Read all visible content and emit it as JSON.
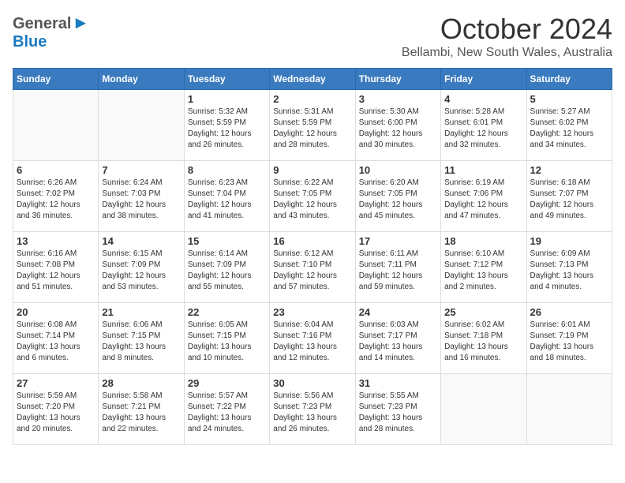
{
  "header": {
    "logo_general": "General",
    "logo_blue": "Blue",
    "month": "October 2024",
    "location": "Bellambi, New South Wales, Australia"
  },
  "weekdays": [
    "Sunday",
    "Monday",
    "Tuesday",
    "Wednesday",
    "Thursday",
    "Friday",
    "Saturday"
  ],
  "weeks": [
    [
      {
        "day": "",
        "info": ""
      },
      {
        "day": "",
        "info": ""
      },
      {
        "day": "1",
        "info": "Sunrise: 5:32 AM\nSunset: 5:59 PM\nDaylight: 12 hours and 26 minutes."
      },
      {
        "day": "2",
        "info": "Sunrise: 5:31 AM\nSunset: 5:59 PM\nDaylight: 12 hours and 28 minutes."
      },
      {
        "day": "3",
        "info": "Sunrise: 5:30 AM\nSunset: 6:00 PM\nDaylight: 12 hours and 30 minutes."
      },
      {
        "day": "4",
        "info": "Sunrise: 5:28 AM\nSunset: 6:01 PM\nDaylight: 12 hours and 32 minutes."
      },
      {
        "day": "5",
        "info": "Sunrise: 5:27 AM\nSunset: 6:02 PM\nDaylight: 12 hours and 34 minutes."
      }
    ],
    [
      {
        "day": "6",
        "info": "Sunrise: 6:26 AM\nSunset: 7:02 PM\nDaylight: 12 hours and 36 minutes."
      },
      {
        "day": "7",
        "info": "Sunrise: 6:24 AM\nSunset: 7:03 PM\nDaylight: 12 hours and 38 minutes."
      },
      {
        "day": "8",
        "info": "Sunrise: 6:23 AM\nSunset: 7:04 PM\nDaylight: 12 hours and 41 minutes."
      },
      {
        "day": "9",
        "info": "Sunrise: 6:22 AM\nSunset: 7:05 PM\nDaylight: 12 hours and 43 minutes."
      },
      {
        "day": "10",
        "info": "Sunrise: 6:20 AM\nSunset: 7:05 PM\nDaylight: 12 hours and 45 minutes."
      },
      {
        "day": "11",
        "info": "Sunrise: 6:19 AM\nSunset: 7:06 PM\nDaylight: 12 hours and 47 minutes."
      },
      {
        "day": "12",
        "info": "Sunrise: 6:18 AM\nSunset: 7:07 PM\nDaylight: 12 hours and 49 minutes."
      }
    ],
    [
      {
        "day": "13",
        "info": "Sunrise: 6:16 AM\nSunset: 7:08 PM\nDaylight: 12 hours and 51 minutes."
      },
      {
        "day": "14",
        "info": "Sunrise: 6:15 AM\nSunset: 7:09 PM\nDaylight: 12 hours and 53 minutes."
      },
      {
        "day": "15",
        "info": "Sunrise: 6:14 AM\nSunset: 7:09 PM\nDaylight: 12 hours and 55 minutes."
      },
      {
        "day": "16",
        "info": "Sunrise: 6:12 AM\nSunset: 7:10 PM\nDaylight: 12 hours and 57 minutes."
      },
      {
        "day": "17",
        "info": "Sunrise: 6:11 AM\nSunset: 7:11 PM\nDaylight: 12 hours and 59 minutes."
      },
      {
        "day": "18",
        "info": "Sunrise: 6:10 AM\nSunset: 7:12 PM\nDaylight: 13 hours and 2 minutes."
      },
      {
        "day": "19",
        "info": "Sunrise: 6:09 AM\nSunset: 7:13 PM\nDaylight: 13 hours and 4 minutes."
      }
    ],
    [
      {
        "day": "20",
        "info": "Sunrise: 6:08 AM\nSunset: 7:14 PM\nDaylight: 13 hours and 6 minutes."
      },
      {
        "day": "21",
        "info": "Sunrise: 6:06 AM\nSunset: 7:15 PM\nDaylight: 13 hours and 8 minutes."
      },
      {
        "day": "22",
        "info": "Sunrise: 6:05 AM\nSunset: 7:15 PM\nDaylight: 13 hours and 10 minutes."
      },
      {
        "day": "23",
        "info": "Sunrise: 6:04 AM\nSunset: 7:16 PM\nDaylight: 13 hours and 12 minutes."
      },
      {
        "day": "24",
        "info": "Sunrise: 6:03 AM\nSunset: 7:17 PM\nDaylight: 13 hours and 14 minutes."
      },
      {
        "day": "25",
        "info": "Sunrise: 6:02 AM\nSunset: 7:18 PM\nDaylight: 13 hours and 16 minutes."
      },
      {
        "day": "26",
        "info": "Sunrise: 6:01 AM\nSunset: 7:19 PM\nDaylight: 13 hours and 18 minutes."
      }
    ],
    [
      {
        "day": "27",
        "info": "Sunrise: 5:59 AM\nSunset: 7:20 PM\nDaylight: 13 hours and 20 minutes."
      },
      {
        "day": "28",
        "info": "Sunrise: 5:58 AM\nSunset: 7:21 PM\nDaylight: 13 hours and 22 minutes."
      },
      {
        "day": "29",
        "info": "Sunrise: 5:57 AM\nSunset: 7:22 PM\nDaylight: 13 hours and 24 minutes."
      },
      {
        "day": "30",
        "info": "Sunrise: 5:56 AM\nSunset: 7:23 PM\nDaylight: 13 hours and 26 minutes."
      },
      {
        "day": "31",
        "info": "Sunrise: 5:55 AM\nSunset: 7:23 PM\nDaylight: 13 hours and 28 minutes."
      },
      {
        "day": "",
        "info": ""
      },
      {
        "day": "",
        "info": ""
      }
    ]
  ]
}
